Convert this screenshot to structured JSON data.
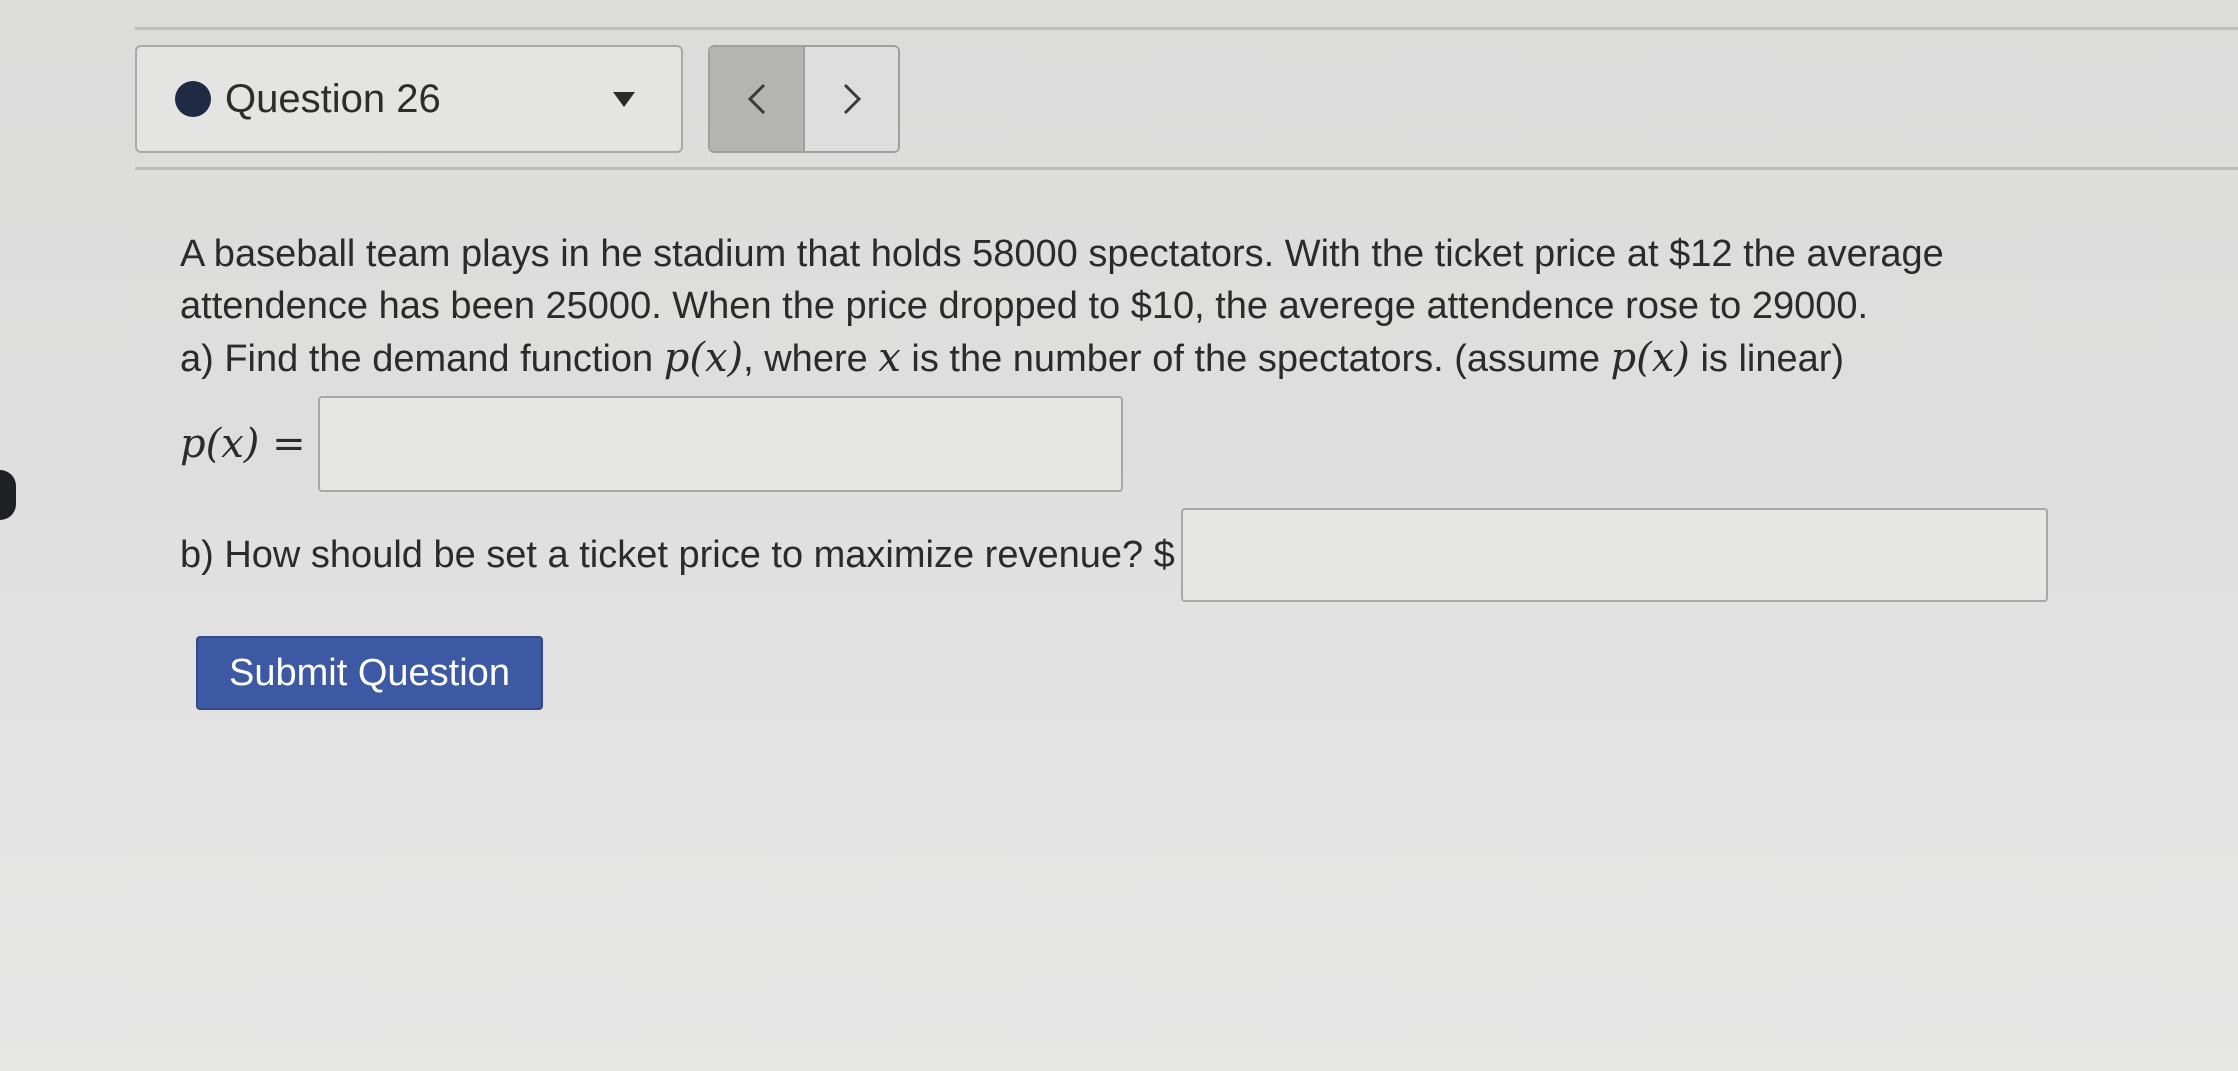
{
  "question_nav": {
    "label": "Question 26",
    "icons": {
      "status": "filled-circle-icon",
      "dropdown": "caret-down-icon",
      "prev": "chevron-left-icon",
      "next": "chevron-right-icon"
    }
  },
  "problem": {
    "line1": "A baseball team plays in he stadium that holds 58000 spectators. With the ticket price at $12 the average",
    "line2": "attendence has been 25000. When the price dropped to $10, the averege attendence rose to 29000.",
    "line3_part1": "a) Find the demand function ",
    "line3_math1": "p(x)",
    "line3_part2": ", where ",
    "line3_math2": "x",
    "line3_part3": " is the number of the spectators. (assume ",
    "line3_math3": "p(x)",
    "line3_part4": " is linear)"
  },
  "part_a": {
    "label": "p(x) =",
    "value": ""
  },
  "part_b": {
    "label": "b) How should be set a ticket price to maximize revenue? $",
    "value": ""
  },
  "submit": {
    "label": "Submit Question"
  },
  "colors": {
    "submit_bg": "#3e59a3",
    "status_dot": "#1f2a44",
    "page_bg": "#dedede"
  }
}
